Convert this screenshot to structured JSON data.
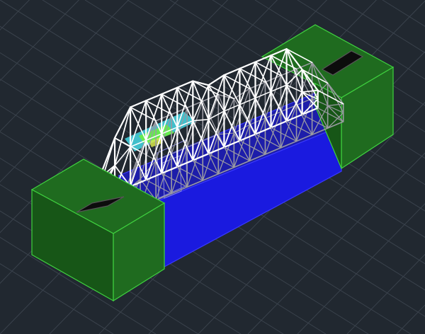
{
  "viewport": {
    "background": "#212830",
    "grid_color": "#3a424c"
  },
  "model": {
    "abutment_fill": "#1f6b1f",
    "abutment_fill_dark": "#175617",
    "abutment_edge": "#3fd13f",
    "water_top": "#1d1daa",
    "water_front": "#1a1adf",
    "water_edge": "#3a3aff",
    "deck_color": "#0c0c0c",
    "truss_color": "#ffffff",
    "truss_shadow": "#9a9aa2",
    "highlight_cyan": "#47d9e6",
    "highlight_green": "#6cf23a",
    "highlight_yellow": "#d8e84a"
  }
}
